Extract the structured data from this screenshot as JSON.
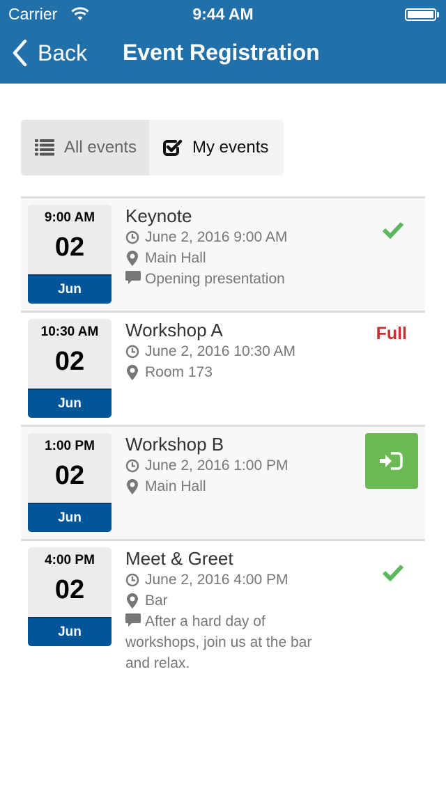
{
  "status_bar": {
    "carrier": "Carrier",
    "time": "9:44 AM",
    "battery_level": 1.0
  },
  "nav": {
    "back_label": "Back",
    "title": "Event Registration"
  },
  "filter": {
    "all_label": "All events",
    "mine_label": "My events",
    "selected": "My events"
  },
  "colors": {
    "header": "#2270aa",
    "month_band": "#03559a",
    "success": "#5cb85c",
    "danger": "#cc2e2e",
    "register": "#6ab954"
  },
  "events": [
    {
      "badge_time": "9:00 AM",
      "badge_day": "02",
      "badge_month": "Jun",
      "title": "Keynote",
      "datetime": "June 2, 2016 9:00 AM",
      "location": "Main Hall",
      "description": "Opening presentation",
      "status": "registered",
      "status_icon": "check-icon"
    },
    {
      "badge_time": "10:30 AM",
      "badge_day": "02",
      "badge_month": "Jun",
      "title": "Workshop A",
      "datetime": "June 2, 2016 10:30 AM",
      "location": "Room 173",
      "description": null,
      "status": "full",
      "status_label": "Full"
    },
    {
      "badge_time": "1:00 PM",
      "badge_day": "02",
      "badge_month": "Jun",
      "title": "Workshop B",
      "datetime": "June 2, 2016 1:00 PM",
      "location": "Main Hall",
      "description": null,
      "status": "open",
      "status_icon": "sign-in-icon"
    },
    {
      "badge_time": "4:00 PM",
      "badge_day": "02",
      "badge_month": "Jun",
      "title": "Meet & Greet",
      "datetime": "June 2, 2016 4:00 PM",
      "location": "Bar",
      "description": "After a hard day of workshops, join us at the bar and relax.",
      "status": "registered",
      "status_icon": "check-icon"
    }
  ]
}
